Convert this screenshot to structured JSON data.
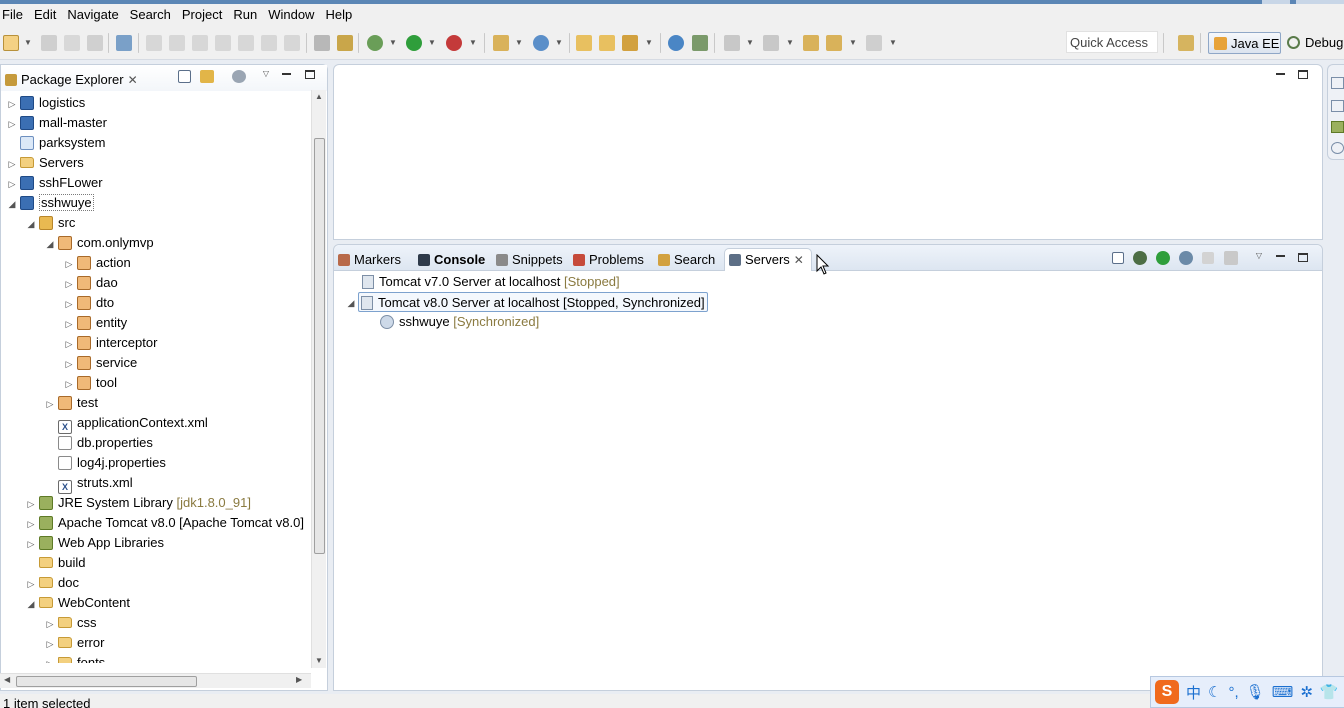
{
  "menu": [
    "File",
    "Edit",
    "Navigate",
    "Search",
    "Project",
    "Run",
    "Window",
    "Help"
  ],
  "toolbar": {
    "quick_access": "Quick Access",
    "perspective_active": "Java EE",
    "perspective_other": "Debug"
  },
  "package_explorer": {
    "title": "Package Explorer",
    "tree": [
      {
        "label": "logistics",
        "decor": "",
        "icon": "proj",
        "twisty": "▷"
      },
      {
        "label": "mall-master",
        "decor": "",
        "icon": "proj",
        "twisty": "▷"
      },
      {
        "label": "parksystem",
        "decor": "",
        "icon": "projw",
        "twisty": ""
      },
      {
        "label": "Servers",
        "decor": "",
        "icon": "folder",
        "twisty": "▷"
      },
      {
        "label": "sshFLower",
        "decor": "",
        "icon": "proj",
        "twisty": "▷"
      },
      {
        "label": "sshwuye",
        "decor": "",
        "icon": "proj",
        "twisty": "◢"
      },
      {
        "label": "src",
        "decor": "",
        "icon": "srcf",
        "twisty": "◢"
      },
      {
        "label": "com.onlymvp",
        "decor": "",
        "icon": "pkg",
        "twisty": "◢"
      },
      {
        "label": "action",
        "decor": "",
        "icon": "pkg",
        "twisty": "▷"
      },
      {
        "label": "dao",
        "decor": "",
        "icon": "pkg",
        "twisty": "▷"
      },
      {
        "label": "dto",
        "decor": "",
        "icon": "pkg",
        "twisty": "▷"
      },
      {
        "label": "entity",
        "decor": "",
        "icon": "pkg",
        "twisty": "▷"
      },
      {
        "label": "interceptor",
        "decor": "",
        "icon": "pkg",
        "twisty": "▷"
      },
      {
        "label": "service",
        "decor": "",
        "icon": "pkg",
        "twisty": "▷"
      },
      {
        "label": "tool",
        "decor": "",
        "icon": "pkg",
        "twisty": "▷"
      },
      {
        "label": "test",
        "decor": "",
        "icon": "pkg",
        "twisty": "▷"
      },
      {
        "label": "applicationContext.xml",
        "decor": "",
        "icon": "xml",
        "twisty": ""
      },
      {
        "label": "db.properties",
        "decor": "",
        "icon": "file",
        "twisty": ""
      },
      {
        "label": "log4j.properties",
        "decor": "",
        "icon": "file",
        "twisty": ""
      },
      {
        "label": "struts.xml",
        "decor": "",
        "icon": "xml",
        "twisty": ""
      },
      {
        "label": "JRE System Library",
        "decor": "[jdk1.8.0_91]",
        "icon": "lib",
        "twisty": "▷"
      },
      {
        "label": "Apache Tomcat v8.0 [Apache Tomcat v8.0]",
        "decor": "",
        "icon": "lib",
        "twisty": "▷"
      },
      {
        "label": "Web App Libraries",
        "decor": "",
        "icon": "lib",
        "twisty": "▷"
      },
      {
        "label": "build",
        "decor": "",
        "icon": "folder",
        "twisty": ""
      },
      {
        "label": "doc",
        "decor": "",
        "icon": "folder",
        "twisty": "▷"
      },
      {
        "label": "WebContent",
        "decor": "",
        "icon": "folder",
        "twisty": "◢"
      },
      {
        "label": "css",
        "decor": "",
        "icon": "folder",
        "twisty": "▷"
      },
      {
        "label": "error",
        "decor": "",
        "icon": "folder",
        "twisty": "▷"
      },
      {
        "label": "fonts",
        "decor": "",
        "icon": "folder",
        "twisty": "▷"
      }
    ]
  },
  "bottom_tabs": [
    "Markers",
    "Console",
    "Snippets",
    "Problems",
    "Search",
    "Servers"
  ],
  "servers": [
    {
      "name": "Tomcat v7.0 Server at localhost",
      "status": "[Stopped]"
    },
    {
      "name": "Tomcat v8.0 Server at localhost",
      "status": "[Stopped, Synchronized]"
    },
    {
      "name": "sshwuye",
      "status": "[Synchronized]"
    }
  ],
  "status": {
    "text": "1 item selected"
  },
  "ime": {
    "logo": "S",
    "lang": "中"
  }
}
